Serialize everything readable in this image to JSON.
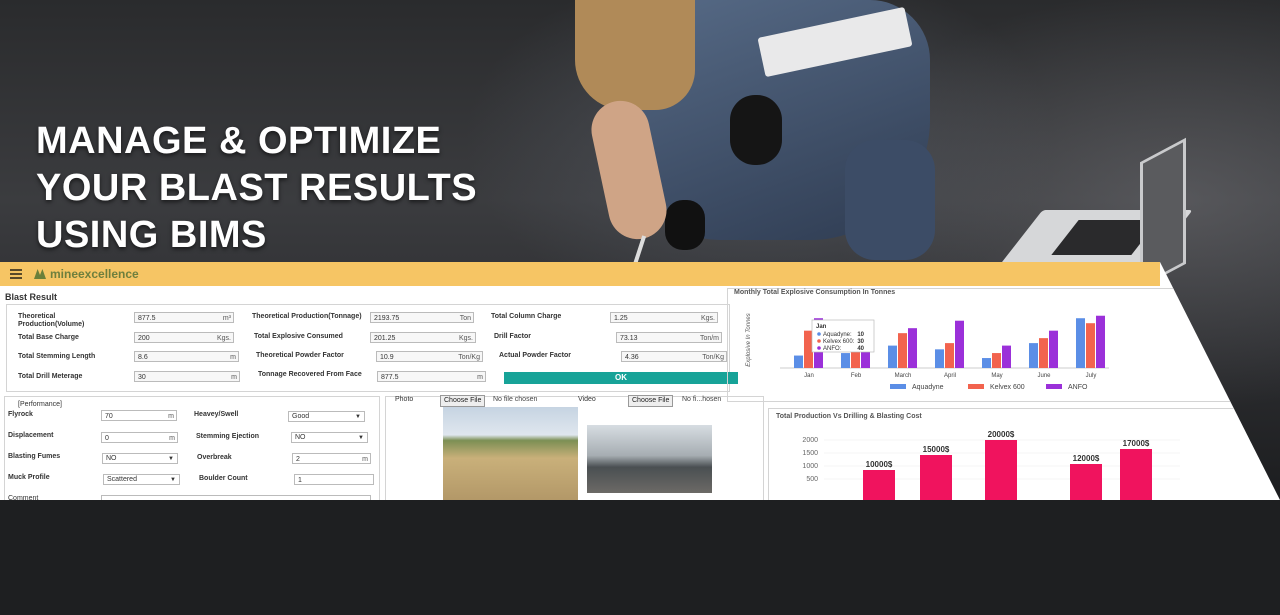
{
  "hero": {
    "lines": [
      "MANAGE & OPTIMIZE",
      "YOUR BLAST RESULTS",
      "USING BIMS"
    ]
  },
  "app": {
    "brand": "mineexcellence",
    "colors": {
      "topbar": "#f6c564",
      "ok_button": "#17a398"
    },
    "blast_result": {
      "title": "Blast Result",
      "fields": [
        {
          "label": "Theoretical Production(Volume)",
          "value": "877.5",
          "unit": "m³"
        },
        {
          "label": "Total Base Charge",
          "value": "200",
          "unit": "Kgs."
        },
        {
          "label": "Total Stemming Length",
          "value": "8.6",
          "unit": "m"
        },
        {
          "label": "Total Drill Meterage",
          "value": "30",
          "unit": "m"
        },
        {
          "label": "Theoretical Production(Tonnage)",
          "value": "2193.75",
          "unit": "Ton"
        },
        {
          "label": "Total Explosive Consumed",
          "value": "201.25",
          "unit": "Kgs."
        },
        {
          "label": "Theoretical Powder Factor",
          "value": "10.9",
          "unit": "Ton/Kg"
        },
        {
          "label": "Tonnage Recovered From Face",
          "value": "877.5",
          "unit": "m"
        },
        {
          "label": "Total Column Charge",
          "value": "1.25",
          "unit": "Kgs."
        },
        {
          "label": "Drill Factor",
          "value": "73.13",
          "unit": "Ton/m"
        },
        {
          "label": "Actual Powder Factor",
          "value": "4.36",
          "unit": "Ton/Kg"
        }
      ],
      "ok_label": "OK"
    },
    "performance": {
      "title": "[Performance]",
      "flyrock": {
        "label": "Flyrock",
        "value": "70",
        "unit": "m"
      },
      "displacement": {
        "label": "Displacement",
        "value": "0",
        "unit": "m"
      },
      "blasting_fumes": {
        "label": "Blasting Fumes",
        "value": "NO"
      },
      "muck_profile": {
        "label": "Muck Profile",
        "value": "Scattered"
      },
      "comment": {
        "label": "Comment"
      },
      "heavey_swell": {
        "label": "Heavey/Swell",
        "value": "Good"
      },
      "stemming_ejection": {
        "label": "Stemming Ejection",
        "value": "NO"
      },
      "overbreak": {
        "label": "Overbreak",
        "value": "2",
        "unit": "m"
      },
      "boulder_count": {
        "label": "Boulder Count",
        "value": "1"
      }
    },
    "media": {
      "photo_label": "Photo",
      "video_label": "Video",
      "choose_file": "Choose File",
      "no_file": "No file chosen",
      "no_file_truncated": "No fi...hosen"
    }
  },
  "chart_data": [
    {
      "type": "bar",
      "title": "Monthly Total Explosive Consumption In Tonnes",
      "ylabel": "Explosive In Tonnes",
      "categories": [
        "Jan",
        "Feb",
        "March",
        "April",
        "May",
        "June",
        "July"
      ],
      "series": [
        {
          "name": "Aquadyne",
          "color": "#5b8ee6",
          "values": [
            10,
            12,
            18,
            15,
            8,
            20,
            40
          ]
        },
        {
          "name": "Kelvex 600",
          "color": "#f2634e",
          "values": [
            30,
            25,
            28,
            20,
            12,
            24,
            36
          ]
        },
        {
          "name": "ANFO",
          "color": "#9b30d9",
          "values": [
            40,
            22,
            32,
            38,
            18,
            30,
            42
          ]
        }
      ],
      "tooltip": {
        "title": "Jan",
        "rows": [
          {
            "name": "Aquadyne",
            "value": "10"
          },
          {
            "name": "Kelvex 600",
            "value": "30"
          },
          {
            "name": "ANFO",
            "value": "40"
          }
        ]
      },
      "legend_position": "bottom"
    },
    {
      "type": "bar",
      "title": "Total Production Vs Drilling & Blasting Cost",
      "yticks": [
        "2000",
        "1500",
        "1000",
        "500"
      ],
      "ylim": [
        0,
        2000
      ],
      "series": [
        {
          "name": "",
          "color": "#f0135e",
          "values": [
            10000,
            15000,
            20000,
            12000,
            17000
          ]
        }
      ],
      "data_labels": [
        "10000$",
        "15000$",
        "20000$",
        "12000$",
        "17000$"
      ]
    }
  ]
}
